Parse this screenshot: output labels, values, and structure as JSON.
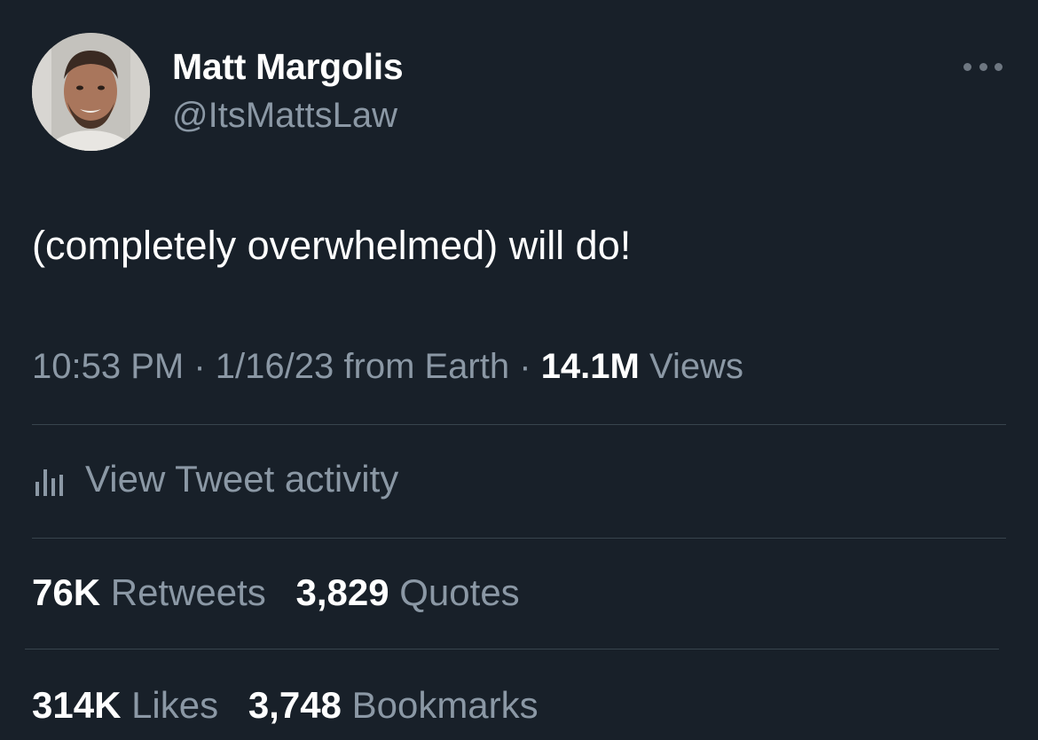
{
  "author": {
    "display_name": "Matt Margolis",
    "handle": "@ItsMattsLaw"
  },
  "tweet": {
    "text": "(completely overwhelmed) will do!",
    "time": "10:53 PM",
    "separator": "·",
    "date": "1/16/23",
    "source": "from Earth",
    "views_count": "14.1M",
    "views_label": "Views"
  },
  "activity": {
    "label": "View Tweet activity"
  },
  "stats": {
    "retweets_count": "76K",
    "retweets_label": "Retweets",
    "quotes_count": "3,829",
    "quotes_label": "Quotes",
    "likes_count": "314K",
    "likes_label": "Likes",
    "bookmarks_count": "3,748",
    "bookmarks_label": "Bookmarks"
  },
  "colors": {
    "background": "#182029",
    "primary_text": "#ffffff",
    "secondary_text": "#8b98a5",
    "divider": "#38444d"
  },
  "icons": {
    "more": "more-horizontal-icon",
    "activity": "bar-chart-icon"
  }
}
